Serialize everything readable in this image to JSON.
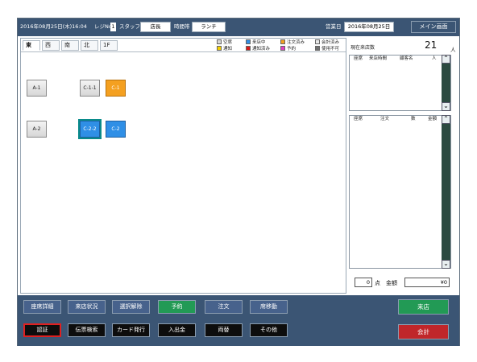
{
  "topbar": {
    "datetime": "2016年08月25日(木)16:04",
    "register_label": "レジNo",
    "register_no": "1",
    "staff_label": "スタッフ",
    "staff_value": "店長",
    "timeslot_label": "時間帯",
    "timeslot_value": "ランチ",
    "business_day_label": "営業日",
    "business_day_value": "2016年08月25日",
    "main_screen_button": "メイン画面"
  },
  "tabs": [
    "東",
    "西",
    "南",
    "北",
    "1F"
  ],
  "active_tab": "東",
  "legend": [
    {
      "label": "空席",
      "color": "#d8d8d8"
    },
    {
      "label": "来店中",
      "color": "#2f8fe6"
    },
    {
      "label": "注文済み",
      "color": "#f4a020"
    },
    {
      "label": "会計済み",
      "color": "#e8e8e8"
    },
    {
      "label": "通知",
      "color": "#f6d000"
    },
    {
      "label": "通知済み",
      "color": "#d81818"
    },
    {
      "label": "予約",
      "color": "#e040c0"
    },
    {
      "label": "使用不可",
      "color": "#707070"
    }
  ],
  "seats": [
    {
      "label": "A-1",
      "state": "empty"
    },
    {
      "label": "C-1-1",
      "state": "empty"
    },
    {
      "label": "C-1",
      "state": "ordered"
    },
    {
      "label": "A-2",
      "state": "empty"
    },
    {
      "label": "C-2-2",
      "state": "visiting-selected"
    },
    {
      "label": "C-2",
      "state": "visiting"
    }
  ],
  "visitors": {
    "label": "現在来店数",
    "count": "21",
    "unit": "人"
  },
  "visit_list": {
    "columns": [
      "座席",
      "来店時間",
      "顧客名",
      "人"
    ]
  },
  "order_list": {
    "columns": [
      "座席",
      "注文",
      "数",
      "金額"
    ]
  },
  "totals": {
    "points": "0",
    "points_unit": "点",
    "amount_label": "金額",
    "amount": "¥0"
  },
  "bottom": {
    "row1": [
      "座席詳細",
      "来店状況",
      "選択解除",
      "予約",
      "注文",
      "席移動"
    ],
    "row2": [
      "認証",
      "伝票検索",
      "カード発行",
      "入出金",
      "両替",
      "その他"
    ],
    "visit_button": "来店",
    "checkout_button": "会計"
  }
}
